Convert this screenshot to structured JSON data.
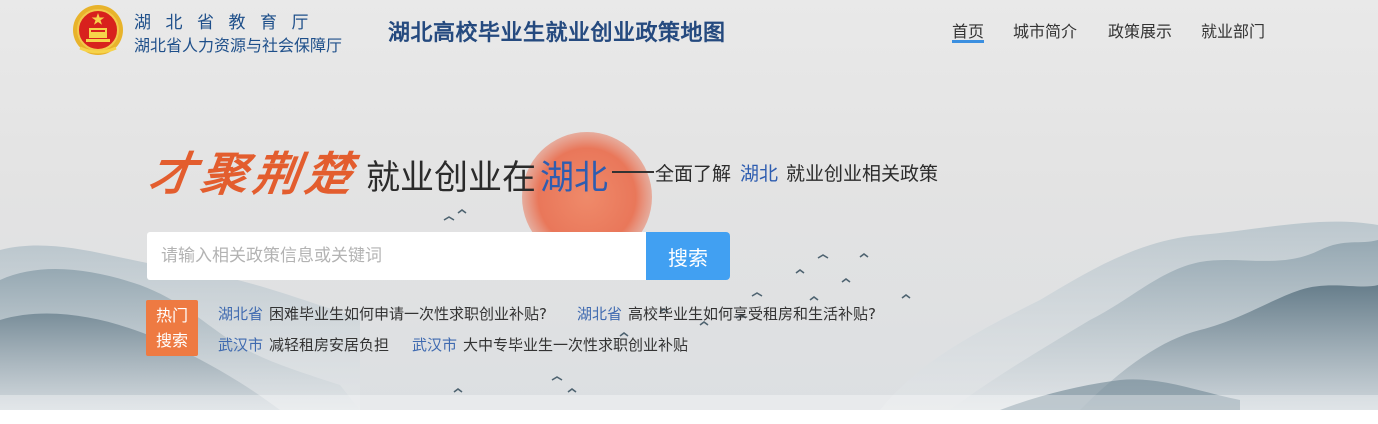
{
  "header": {
    "dept_line1": "湖北省教育厅",
    "dept_line2": "湖北省人力资源与社会保障厅",
    "site_title": "湖北高校毕业生就业创业政策地图",
    "emblem_icon": "national-emblem-icon"
  },
  "nav": {
    "items": [
      {
        "label": "首页",
        "active": true
      },
      {
        "label": "城市简介",
        "active": false
      },
      {
        "label": "政策展示",
        "active": false
      },
      {
        "label": "就业部门",
        "active": false
      }
    ]
  },
  "slogan": {
    "calligraphy": "才聚荆楚",
    "main": "就业创业在",
    "main_highlight": "湖北",
    "sub_prefix": "全面了解",
    "sub_highlight": "湖北",
    "sub_suffix": "就业创业相关政策"
  },
  "search": {
    "placeholder": "请输入相关政策信息或关键词",
    "value": "",
    "button_label": "搜索"
  },
  "hot_search": {
    "label_line1": "热门",
    "label_line2": "搜索",
    "items": [
      {
        "region": "湖北省",
        "question": "困难毕业生如何申请一次性求职创业补贴?"
      },
      {
        "region": "湖北省",
        "question": "高校毕业生如何享受租房和生活补贴?"
      },
      {
        "region": "武汉市",
        "question": "减轻租房安居负担"
      },
      {
        "region": "武汉市",
        "question": "大中专毕业生一次性求职创业补贴"
      }
    ]
  },
  "colors": {
    "accent": "#41a0f2",
    "hot_badge": "#ee7a42",
    "calligraphy": "#e35d2e",
    "title_blue": "#254a7f",
    "region_blue": "#3f6ab0"
  }
}
